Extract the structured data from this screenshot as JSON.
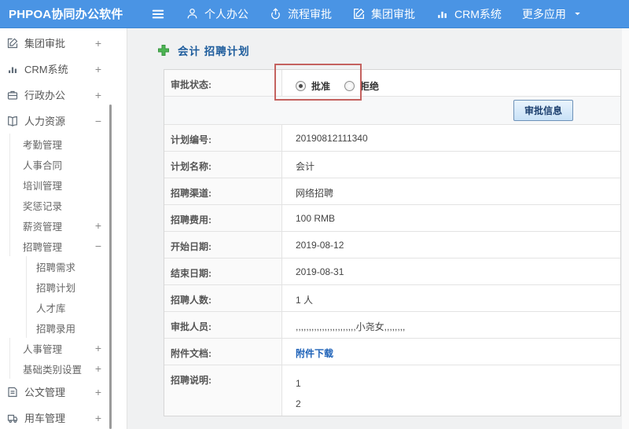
{
  "header": {
    "logo": "PHPOA协同办公软件",
    "nav": [
      {
        "label": "个人办公",
        "icon": "user"
      },
      {
        "label": "流程审批",
        "icon": "flow"
      },
      {
        "label": "集团审批",
        "icon": "edit"
      },
      {
        "label": "CRM系统",
        "icon": "chart"
      },
      {
        "label": "更多应用",
        "icon": "caret",
        "caret": true
      }
    ]
  },
  "sidebar": {
    "items": [
      {
        "label": "集团审批",
        "icon": "edit",
        "level": 0,
        "expand": "+"
      },
      {
        "label": "CRM系统",
        "icon": "chart",
        "level": 0,
        "expand": "+"
      },
      {
        "label": "行政办公",
        "icon": "briefcase",
        "level": 0,
        "expand": "+"
      },
      {
        "label": "人力资源",
        "icon": "book",
        "level": 0,
        "expand": "−"
      },
      {
        "label": "考勤管理",
        "level": 1
      },
      {
        "label": "人事合同",
        "level": 1
      },
      {
        "label": "培训管理",
        "level": 1
      },
      {
        "label": "奖惩记录",
        "level": 1
      },
      {
        "label": "薪资管理",
        "level": 1,
        "expand": "+"
      },
      {
        "label": "招聘管理",
        "level": 1,
        "expand": "−"
      },
      {
        "label": "招聘需求",
        "level": 2
      },
      {
        "label": "招聘计划",
        "level": 2
      },
      {
        "label": "人才库",
        "level": 2
      },
      {
        "label": "招聘录用",
        "level": 2
      },
      {
        "label": "人事管理",
        "level": 1,
        "expand": "+"
      },
      {
        "label": "基础类别设置",
        "level": 1,
        "expand": "+"
      },
      {
        "label": "公文管理",
        "icon": "doc",
        "level": 0,
        "expand": "+"
      },
      {
        "label": "用车管理",
        "icon": "truck",
        "level": 0,
        "expand": "+"
      }
    ]
  },
  "main": {
    "title": "会计 招聘计划",
    "status_row": {
      "label": "审批状态:",
      "options": [
        {
          "label": "批准",
          "selected": true
        },
        {
          "label": "拒绝",
          "selected": false
        }
      ]
    },
    "approve_button": "审批信息",
    "rows": [
      {
        "label": "计划编号:",
        "value": "20190812111340"
      },
      {
        "label": "计划名称:",
        "value": "会计"
      },
      {
        "label": "招聘渠道:",
        "value": "网络招聘"
      },
      {
        "label": "招聘费用:",
        "value": "100 RMB"
      },
      {
        "label": "开始日期:",
        "value": "2019-08-12"
      },
      {
        "label": "结束日期:",
        "value": "2019-08-31"
      },
      {
        "label": "招聘人数:",
        "value": "1 人"
      },
      {
        "label": "审批人员:",
        "value": ",,,,,,,,,,,,,,,,,,,,,,,小尧女,,,,,,,,"
      },
      {
        "label": "附件文档:",
        "value": "附件下载",
        "type": "link"
      },
      {
        "label": "招聘说明:",
        "lines": [
          "1",
          "2"
        ],
        "type": "multiline"
      }
    ]
  },
  "colors": {
    "header_blue": "#4a94e4",
    "title_blue": "#1d5c9c",
    "link_blue": "#1e62b8",
    "annotation_red": "#c4625f",
    "plus_green": "#4db553"
  }
}
